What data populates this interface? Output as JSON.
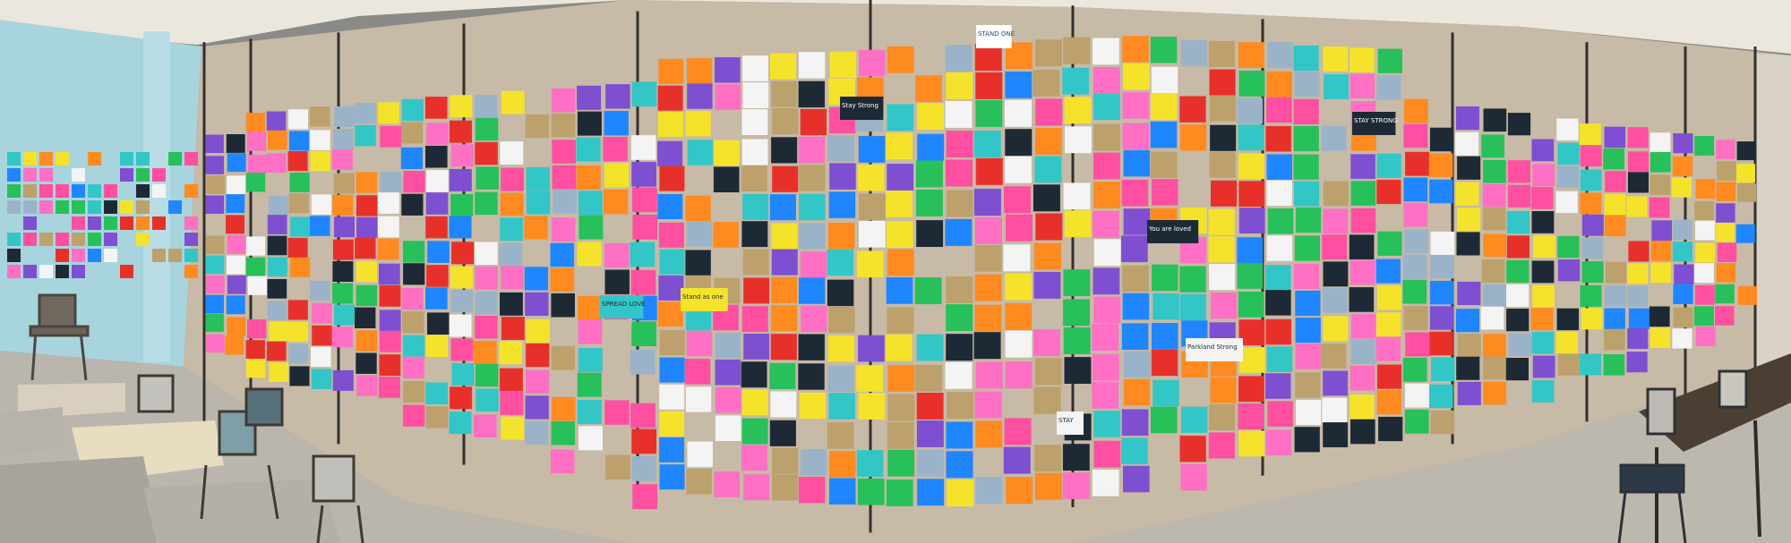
{
  "scene": {
    "palette": {
      "wall": "#c6b9a6",
      "blue_wall": "#a7d3dc",
      "ceiling": "#ede8e0",
      "floor": "#b9b4ab",
      "frame": "#33302c",
      "notes": [
        "#ff4fa0",
        "#ff8a1f",
        "#f5e32b",
        "#27c05a",
        "#1f86ff",
        "#1d2a36",
        "#f4f4f4",
        "#e8302b",
        "#33c6c6",
        "#7e4fd1",
        "#bca16c",
        "#ff6fc4",
        "#9bb3c9"
      ]
    },
    "texts": {
      "panel_top": "STAND ONE",
      "note_stay_strong": "Stay Strong",
      "note_stand_as_one": "Stand as one",
      "note_you_are_loved": "You are loved",
      "note_stay_strong_2": "STAY STRONG",
      "note_parkland": "Parkland Strong",
      "note_spread_love": "SPREAD LOVE",
      "note_stay": "STAY"
    }
  }
}
